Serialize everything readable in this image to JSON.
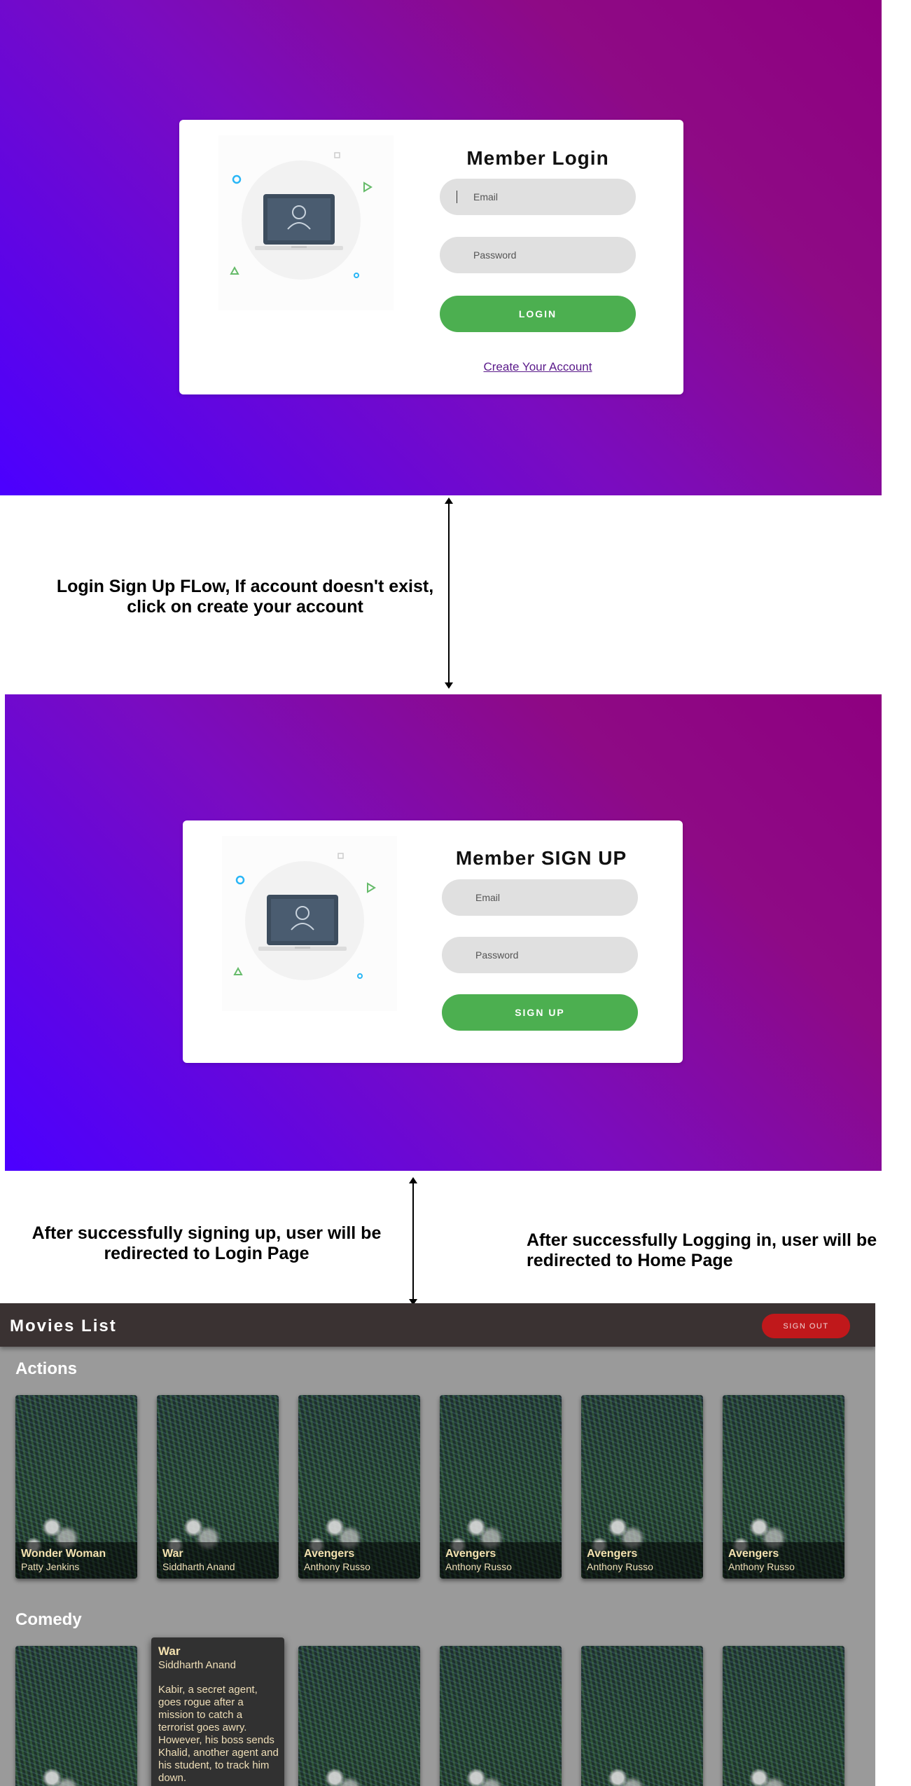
{
  "login": {
    "title": "Member Login",
    "email_placeholder": "Email",
    "password_placeholder": "Password",
    "button": "LOGIN",
    "create_link": "Create Your Account"
  },
  "signup": {
    "title": "Member SIGN UP",
    "email_placeholder": "Email",
    "password_placeholder": "Password",
    "button": "SIGN UP"
  },
  "notes": {
    "flow": "Login Sign Up FLow, If account doesn't exist, click on create your account",
    "after_signup": "After successfully signing up, user will be redirected to Login Page",
    "after_login": "After successfully Logging in, user will be redirected to Home Page"
  },
  "movies": {
    "title": "Movies List",
    "sign_out": "SIGN OUT",
    "sections": [
      {
        "title": "Actions",
        "items": [
          {
            "name": "Wonder Woman",
            "director": "Patty Jenkins"
          },
          {
            "name": "War",
            "director": "Siddharth Anand"
          },
          {
            "name": "Avengers",
            "director": "Anthony Russo"
          },
          {
            "name": "Avengers",
            "director": "Anthony Russo"
          },
          {
            "name": "Avengers",
            "director": "Anthony Russo"
          },
          {
            "name": "Avengers",
            "director": "Anthony Russo"
          }
        ]
      },
      {
        "title": "Comedy",
        "hover_item": {
          "name": "War",
          "director": "Siddharth Anand",
          "description": "Kabir, a secret agent, goes rogue after a mission to catch a terrorist goes awry. However, his boss sends Khalid, another agent and his student, to track him down."
        }
      }
    ]
  },
  "colors": {
    "gradient_start": "#4b00ff",
    "gradient_end": "#8e0080",
    "button_green": "#4caf50",
    "sign_out_red": "#c0181b",
    "header_dark": "#3a3232",
    "movies_bg": "#9a9a9a"
  }
}
